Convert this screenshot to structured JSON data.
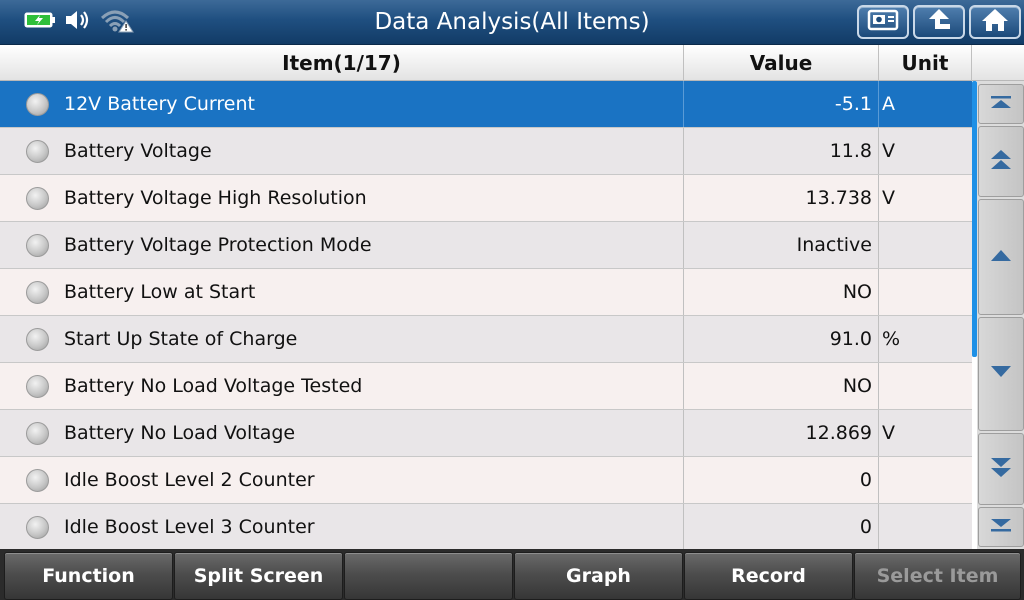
{
  "title": "Data Analysis(All Items)",
  "status_icons": [
    "battery-charging-icon",
    "speaker-icon",
    "wifi-warning-icon"
  ],
  "toolbar_buttons": [
    "screenshot-icon",
    "back-icon",
    "home-icon"
  ],
  "table": {
    "headers": {
      "item": "Item(1/17)",
      "value": "Value",
      "unit": "Unit"
    },
    "selected_index": 0,
    "rows": [
      {
        "name": "12V Battery Current",
        "value": "-5.1",
        "unit": "A"
      },
      {
        "name": "Battery Voltage",
        "value": "11.8",
        "unit": "V"
      },
      {
        "name": "Battery Voltage High Resolution",
        "value": "13.738",
        "unit": "V"
      },
      {
        "name": "Battery Voltage Protection Mode",
        "value": "Inactive",
        "unit": ""
      },
      {
        "name": "Battery Low at Start",
        "value": "NO",
        "unit": ""
      },
      {
        "name": "Start Up State of Charge",
        "value": "91.0",
        "unit": "%"
      },
      {
        "name": "Battery No Load Voltage Tested",
        "value": "NO",
        "unit": ""
      },
      {
        "name": "Battery No Load Voltage",
        "value": "12.869",
        "unit": "V"
      },
      {
        "name": "Idle Boost Level 2 Counter",
        "value": "0",
        "unit": ""
      },
      {
        "name": "Idle Boost Level 3 Counter",
        "value": "0",
        "unit": ""
      }
    ]
  },
  "scroll": {
    "buttons": [
      "scroll-top-icon",
      "page-up-icon",
      "line-up-icon",
      "line-down-icon",
      "page-down-icon",
      "scroll-bottom-icon"
    ],
    "visible_fraction": 0.59,
    "position_fraction": 0.0
  },
  "bottom_toolbar": [
    {
      "label": "Function",
      "enabled": true
    },
    {
      "label": "Split Screen",
      "enabled": true
    },
    {
      "label": "",
      "enabled": true
    },
    {
      "label": "Graph",
      "enabled": true
    },
    {
      "label": "Record",
      "enabled": true
    },
    {
      "label": "Select Item",
      "enabled": false
    }
  ],
  "colors": {
    "title_bar": "#1f4f80",
    "selected_row": "#1a73c3",
    "row_odd": "#f7f0ef",
    "row_even": "#e9e6e8",
    "scroll_thumb": "#1e90e6",
    "toolbar": "#4d4d4d"
  }
}
